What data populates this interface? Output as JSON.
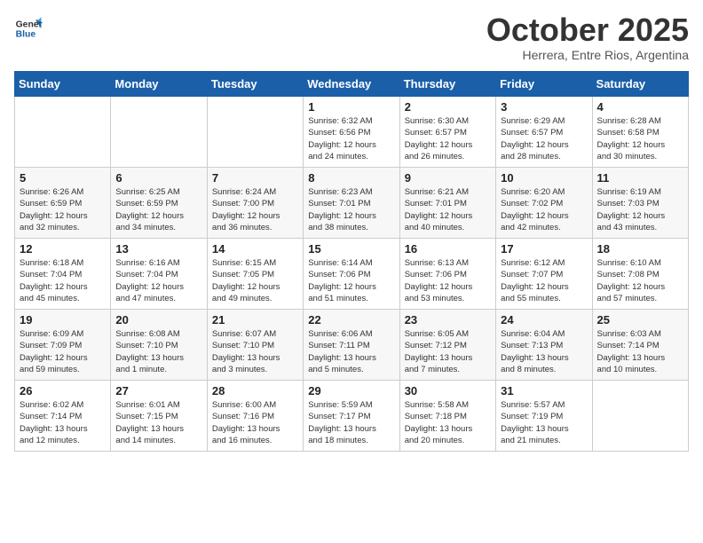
{
  "logo": {
    "line1": "General",
    "line2": "Blue"
  },
  "title": "October 2025",
  "subtitle": "Herrera, Entre Rios, Argentina",
  "days_of_week": [
    "Sunday",
    "Monday",
    "Tuesday",
    "Wednesday",
    "Thursday",
    "Friday",
    "Saturday"
  ],
  "weeks": [
    [
      {
        "day": "",
        "info": ""
      },
      {
        "day": "",
        "info": ""
      },
      {
        "day": "",
        "info": ""
      },
      {
        "day": "1",
        "info": "Sunrise: 6:32 AM\nSunset: 6:56 PM\nDaylight: 12 hours\nand 24 minutes."
      },
      {
        "day": "2",
        "info": "Sunrise: 6:30 AM\nSunset: 6:57 PM\nDaylight: 12 hours\nand 26 minutes."
      },
      {
        "day": "3",
        "info": "Sunrise: 6:29 AM\nSunset: 6:57 PM\nDaylight: 12 hours\nand 28 minutes."
      },
      {
        "day": "4",
        "info": "Sunrise: 6:28 AM\nSunset: 6:58 PM\nDaylight: 12 hours\nand 30 minutes."
      }
    ],
    [
      {
        "day": "5",
        "info": "Sunrise: 6:26 AM\nSunset: 6:59 PM\nDaylight: 12 hours\nand 32 minutes."
      },
      {
        "day": "6",
        "info": "Sunrise: 6:25 AM\nSunset: 6:59 PM\nDaylight: 12 hours\nand 34 minutes."
      },
      {
        "day": "7",
        "info": "Sunrise: 6:24 AM\nSunset: 7:00 PM\nDaylight: 12 hours\nand 36 minutes."
      },
      {
        "day": "8",
        "info": "Sunrise: 6:23 AM\nSunset: 7:01 PM\nDaylight: 12 hours\nand 38 minutes."
      },
      {
        "day": "9",
        "info": "Sunrise: 6:21 AM\nSunset: 7:01 PM\nDaylight: 12 hours\nand 40 minutes."
      },
      {
        "day": "10",
        "info": "Sunrise: 6:20 AM\nSunset: 7:02 PM\nDaylight: 12 hours\nand 42 minutes."
      },
      {
        "day": "11",
        "info": "Sunrise: 6:19 AM\nSunset: 7:03 PM\nDaylight: 12 hours\nand 43 minutes."
      }
    ],
    [
      {
        "day": "12",
        "info": "Sunrise: 6:18 AM\nSunset: 7:04 PM\nDaylight: 12 hours\nand 45 minutes."
      },
      {
        "day": "13",
        "info": "Sunrise: 6:16 AM\nSunset: 7:04 PM\nDaylight: 12 hours\nand 47 minutes."
      },
      {
        "day": "14",
        "info": "Sunrise: 6:15 AM\nSunset: 7:05 PM\nDaylight: 12 hours\nand 49 minutes."
      },
      {
        "day": "15",
        "info": "Sunrise: 6:14 AM\nSunset: 7:06 PM\nDaylight: 12 hours\nand 51 minutes."
      },
      {
        "day": "16",
        "info": "Sunrise: 6:13 AM\nSunset: 7:06 PM\nDaylight: 12 hours\nand 53 minutes."
      },
      {
        "day": "17",
        "info": "Sunrise: 6:12 AM\nSunset: 7:07 PM\nDaylight: 12 hours\nand 55 minutes."
      },
      {
        "day": "18",
        "info": "Sunrise: 6:10 AM\nSunset: 7:08 PM\nDaylight: 12 hours\nand 57 minutes."
      }
    ],
    [
      {
        "day": "19",
        "info": "Sunrise: 6:09 AM\nSunset: 7:09 PM\nDaylight: 12 hours\nand 59 minutes."
      },
      {
        "day": "20",
        "info": "Sunrise: 6:08 AM\nSunset: 7:10 PM\nDaylight: 13 hours\nand 1 minute."
      },
      {
        "day": "21",
        "info": "Sunrise: 6:07 AM\nSunset: 7:10 PM\nDaylight: 13 hours\nand 3 minutes."
      },
      {
        "day": "22",
        "info": "Sunrise: 6:06 AM\nSunset: 7:11 PM\nDaylight: 13 hours\nand 5 minutes."
      },
      {
        "day": "23",
        "info": "Sunrise: 6:05 AM\nSunset: 7:12 PM\nDaylight: 13 hours\nand 7 minutes."
      },
      {
        "day": "24",
        "info": "Sunrise: 6:04 AM\nSunset: 7:13 PM\nDaylight: 13 hours\nand 8 minutes."
      },
      {
        "day": "25",
        "info": "Sunrise: 6:03 AM\nSunset: 7:14 PM\nDaylight: 13 hours\nand 10 minutes."
      }
    ],
    [
      {
        "day": "26",
        "info": "Sunrise: 6:02 AM\nSunset: 7:14 PM\nDaylight: 13 hours\nand 12 minutes."
      },
      {
        "day": "27",
        "info": "Sunrise: 6:01 AM\nSunset: 7:15 PM\nDaylight: 13 hours\nand 14 minutes."
      },
      {
        "day": "28",
        "info": "Sunrise: 6:00 AM\nSunset: 7:16 PM\nDaylight: 13 hours\nand 16 minutes."
      },
      {
        "day": "29",
        "info": "Sunrise: 5:59 AM\nSunset: 7:17 PM\nDaylight: 13 hours\nand 18 minutes."
      },
      {
        "day": "30",
        "info": "Sunrise: 5:58 AM\nSunset: 7:18 PM\nDaylight: 13 hours\nand 20 minutes."
      },
      {
        "day": "31",
        "info": "Sunrise: 5:57 AM\nSunset: 7:19 PM\nDaylight: 13 hours\nand 21 minutes."
      },
      {
        "day": "",
        "info": ""
      }
    ]
  ]
}
